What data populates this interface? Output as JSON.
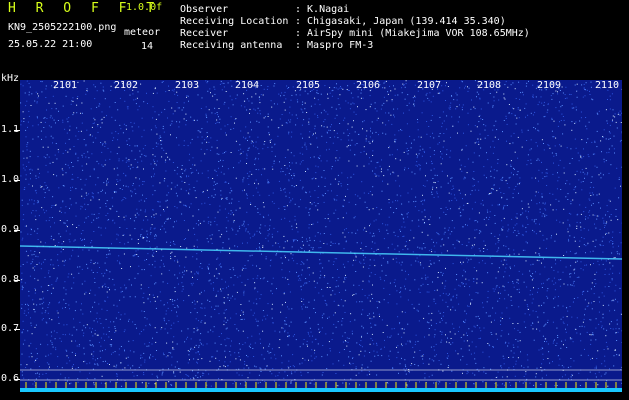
{
  "header": {
    "title": "H R O F F T",
    "version": "1.0.0f",
    "filename": "KN9_2505222100.png",
    "meteor_label": "meteor",
    "datetime": "25.05.22 21:00",
    "meteor_count": "14"
  },
  "info": [
    {
      "key": "Observer",
      "value": ": K.Nagai"
    },
    {
      "key": "Receiving Location",
      "value": ": Chigasaki, Japan (139.414 35.340)"
    },
    {
      "key": "Receiver",
      "value": ": AirSpy mini (Miakejima VOR 108.65MHz)"
    },
    {
      "key": "Receiving antenna",
      "value": ": Maspro FM-3"
    }
  ],
  "axis": {
    "y_unit": "kHz",
    "y_ticks": [
      "1.1",
      "1.0",
      "0.9",
      "0.8",
      "0.7",
      "0.6"
    ],
    "x_ticks": [
      "2101",
      "2102",
      "2103",
      "2104",
      "2105",
      "2106",
      "2107",
      "2108",
      "2109",
      "2110"
    ]
  },
  "colors": {
    "background": "#000000",
    "spectrogram_base": "#0a1a8c",
    "noise_dot": "#6fa8ff",
    "carrier_line": "#49d3ff",
    "baseline_strip": "#19c8ff",
    "header_green": "#d8ff1a"
  }
}
